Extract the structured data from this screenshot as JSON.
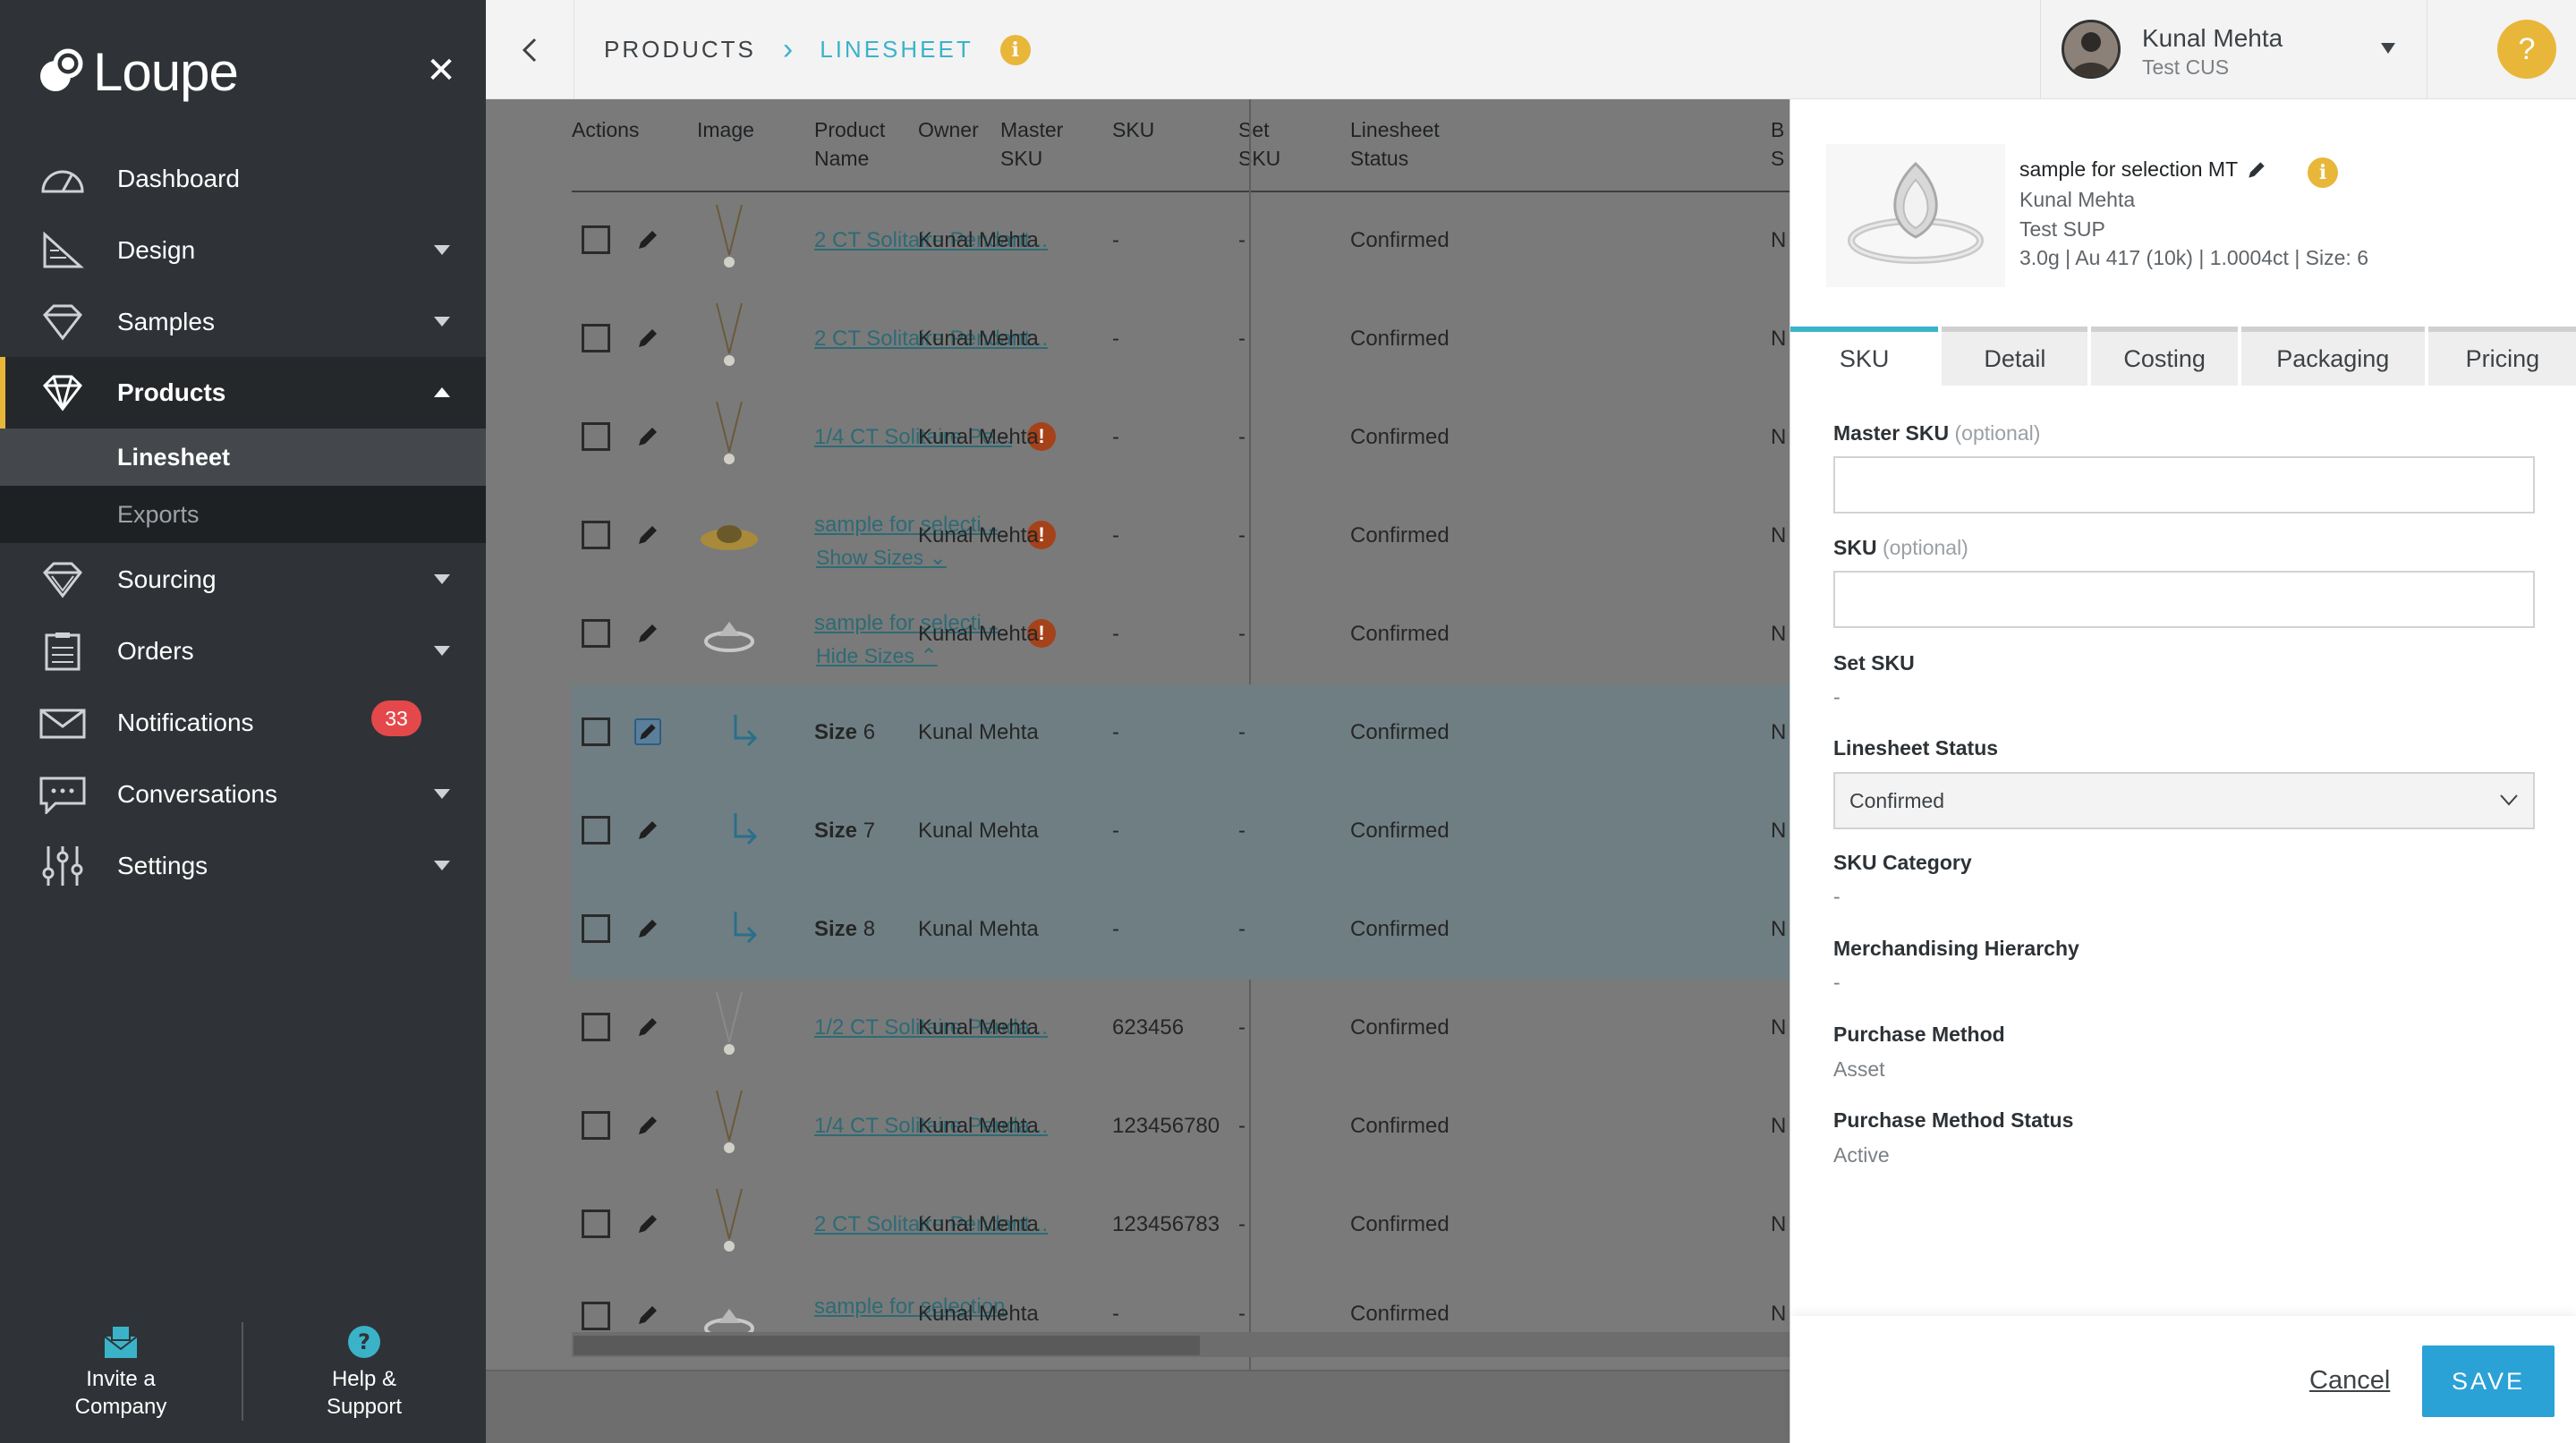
{
  "app": {
    "name": "Loupe"
  },
  "sidebar": {
    "items": [
      {
        "label": "Dashboard"
      },
      {
        "label": "Design"
      },
      {
        "label": "Samples"
      },
      {
        "label": "Products"
      },
      {
        "label": "Sourcing"
      },
      {
        "label": "Orders"
      },
      {
        "label": "Notifications",
        "badge": "33"
      },
      {
        "label": "Conversations"
      },
      {
        "label": "Settings"
      }
    ],
    "subitems": [
      {
        "label": "Linesheet"
      },
      {
        "label": "Exports"
      }
    ],
    "bottom": {
      "invite": {
        "line1": "Invite a",
        "line2": "Company"
      },
      "help": {
        "line1": "Help &",
        "line2": "Support"
      }
    }
  },
  "breadcrumb": {
    "parent": "PRODUCTS",
    "current": "LINESHEET"
  },
  "user": {
    "name": "Kunal Mehta",
    "company": "Test CUS"
  },
  "help_button": "?",
  "table": {
    "headers": {
      "actions": "Actions",
      "image": "Image",
      "product_name": "Product\nName",
      "owner": "Owner",
      "master_sku": "Master\nSKU",
      "sku": "SKU",
      "set_sku": "Set\nSKU",
      "status": "Linesheet\nStatus",
      "b": "B\nS"
    },
    "rows": [
      {
        "name": "2 CT Solitaire Pendant...",
        "owner": "Kunal Mehta",
        "msku": "-",
        "sku": "-",
        "ssku": "-",
        "status": "Confirmed",
        "b": "N"
      },
      {
        "name": "2 CT Solitaire Pendant...",
        "owner": "Kunal Mehta",
        "msku": "-",
        "sku": "-",
        "ssku": "-",
        "status": "Confirmed",
        "b": "N"
      },
      {
        "name": "1/4 CT Solitaire Pe...",
        "owner": "Kunal Mehta",
        "msku": "-",
        "sku": "-",
        "ssku": "-",
        "status": "Confirmed",
        "b": "N"
      },
      {
        "name": "sample for selecti...",
        "toggle": "Show Sizes",
        "owner": "Kunal Mehta",
        "msku": "-",
        "sku": "-",
        "ssku": "-",
        "status": "Confirmed",
        "b": "N"
      },
      {
        "name": "sample for selecti...",
        "toggle": "Hide Sizes",
        "owner": "Kunal Mehta",
        "msku": "-",
        "sku": "-",
        "ssku": "-",
        "status": "Confirmed",
        "b": "N"
      },
      {
        "size_label": "Size",
        "size_value": "6",
        "owner": "Kunal Mehta",
        "msku": "-",
        "sku": "-",
        "ssku": "-",
        "status": "Confirmed",
        "b": "N"
      },
      {
        "size_label": "Size",
        "size_value": "7",
        "owner": "Kunal Mehta",
        "msku": "-",
        "sku": "-",
        "ssku": "-",
        "status": "Confirmed",
        "b": "N"
      },
      {
        "size_label": "Size",
        "size_value": "8",
        "owner": "Kunal Mehta",
        "msku": "-",
        "sku": "-",
        "ssku": "-",
        "status": "Confirmed",
        "b": "N"
      },
      {
        "name": "1/2 CT Solitaire Penda...",
        "owner": "Kunal Mehta",
        "msku": "-",
        "sku": "623456",
        "ssku": "-",
        "status": "Confirmed",
        "b": "N"
      },
      {
        "name": "1/4 CT Solitaire Penda...",
        "owner": "Kunal Mehta",
        "msku": "-",
        "sku": "123456780",
        "ssku": "-",
        "status": "Confirmed",
        "b": "N"
      },
      {
        "name": "2 CT Solitaire Pendant...",
        "owner": "Kunal Mehta",
        "msku": "-",
        "sku": "123456783",
        "ssku": "-",
        "status": "Confirmed",
        "b": "N"
      },
      {
        "name": "sample for selection",
        "owner": "Kunal Mehta",
        "msku": "-",
        "sku": "-",
        "ssku": "-",
        "status": "Confirmed",
        "b": "N"
      }
    ]
  },
  "panel": {
    "title": "sample for selection MT",
    "owner": "Kunal Mehta",
    "company": "Test SUP",
    "specs": "3.0g | Au 417 (10k) | 1.0004ct | Size: 6",
    "tabs": [
      {
        "label": "SKU"
      },
      {
        "label": "Detail"
      },
      {
        "label": "Costing"
      },
      {
        "label": "Packaging"
      },
      {
        "label": "Pricing"
      }
    ],
    "fields": {
      "master_sku": {
        "label": "Master SKU",
        "optional": "(optional)",
        "value": ""
      },
      "sku": {
        "label": "SKU",
        "optional": "(optional)",
        "value": ""
      },
      "set_sku": {
        "label": "Set SKU",
        "value": "-"
      },
      "linesheet_status": {
        "label": "Linesheet Status",
        "value": "Confirmed"
      },
      "sku_category": {
        "label": "SKU Category",
        "value": "-"
      },
      "merch_hierarchy": {
        "label": "Merchandising Hierarchy",
        "value": "-"
      },
      "purchase_method": {
        "label": "Purchase Method",
        "value": "Asset"
      },
      "purchase_method_status": {
        "label": "Purchase Method Status",
        "value": "Active"
      }
    },
    "cancel": "Cancel",
    "save": "SAVE"
  },
  "colors": {
    "accent": "#3ab3c9",
    "brand_yellow": "#e8b73a",
    "save_blue": "#2ba2d6",
    "badge_red": "#e4484a",
    "sidebar": "#2f3337"
  }
}
